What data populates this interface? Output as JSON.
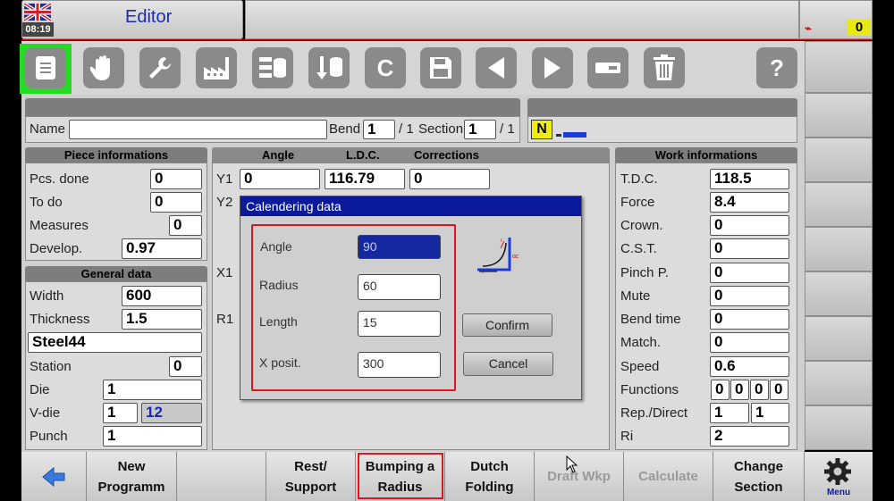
{
  "status": {
    "time": "08:19",
    "title": "Editor",
    "counter": "0"
  },
  "toolbar": {
    "help_label": "?",
    "c_label": "C"
  },
  "name_row": {
    "name_label": "Name",
    "name_value": "",
    "bend_label": "Bend",
    "bend_value": "1",
    "bend_total": "/ 1",
    "section_label": "Section",
    "section_value": "1",
    "section_total": "/ 1",
    "mode_badge": "N"
  },
  "piece": {
    "header": "Piece informations",
    "rows": [
      {
        "label": "Pcs. done",
        "value": "0"
      },
      {
        "label": "To do",
        "value": "0"
      },
      {
        "label": "Measures",
        "value": "0"
      },
      {
        "label": "Develop.",
        "value": "0.97"
      }
    ]
  },
  "general": {
    "header": "General data",
    "width_label": "Width",
    "width_value": "600",
    "thickness_label": "Thickness",
    "thickness_value": "1.5",
    "material": "Steel44",
    "station_label": "Station",
    "station_value": "0",
    "die_label": "Die",
    "die_value": "1",
    "vdie_label": "V-die",
    "vdie_value": "1",
    "vdie_value2": "12",
    "punch_label": "Punch",
    "punch_value": "1"
  },
  "axes": {
    "col_angle": "Angle",
    "col_ldc": "L.D.C.",
    "col_corr": "Corrections",
    "y1_label": "Y1",
    "y1_angle": "0",
    "y1_ldc": "116.79",
    "y1_corr": "0",
    "y2_label": "Y2",
    "x1_label": "X1",
    "r1_label": "R1"
  },
  "work": {
    "header": "Work informations",
    "rows": [
      {
        "label": "T.D.C.",
        "value": "118.5"
      },
      {
        "label": "Force",
        "value": "8.4"
      },
      {
        "label": "Crown.",
        "value": "0"
      },
      {
        "label": "C.S.T.",
        "value": "0"
      },
      {
        "label": "Pinch P.",
        "value": "0"
      },
      {
        "label": "Mute",
        "value": "0"
      },
      {
        "label": "Bend time",
        "value": "0"
      },
      {
        "label": "Match.",
        "value": "0"
      },
      {
        "label": "Speed",
        "value": "0.6"
      }
    ],
    "functions_label": "Functions",
    "functions_values": [
      "0",
      "0",
      "0",
      "0"
    ],
    "rep_label": "Rep./Direct",
    "rep_values": [
      "1",
      "1"
    ],
    "ri_label": "Ri",
    "ri_value": "2"
  },
  "dialog": {
    "title": "Calendering data",
    "angle_label": "Angle",
    "angle_value": "90",
    "radius_label": "Radius",
    "radius_value": "60",
    "length_label": "Length",
    "length_value": "15",
    "xpos_label": "X posit.",
    "xpos_value": "300",
    "confirm_label": "Confirm",
    "cancel_label": "Cancel",
    "diagram_label": "αc"
  },
  "softkeys": {
    "new_line1": "New",
    "new_line2": "Programm",
    "rest_line1": "Rest/",
    "rest_line2": "Support",
    "bump_line1": "Bumping a",
    "bump_line2": "Radius",
    "dutch_line1": "Dutch",
    "dutch_line2": "Folding",
    "draft": "Draft Wkp",
    "calculate": "Calculate",
    "change_line1": "Change",
    "change_line2": "Section",
    "menu": "Menu"
  },
  "colors": {
    "highlight": "#e0141e",
    "selected": "#22dd22",
    "dialog_title": "#0b1a9a"
  }
}
